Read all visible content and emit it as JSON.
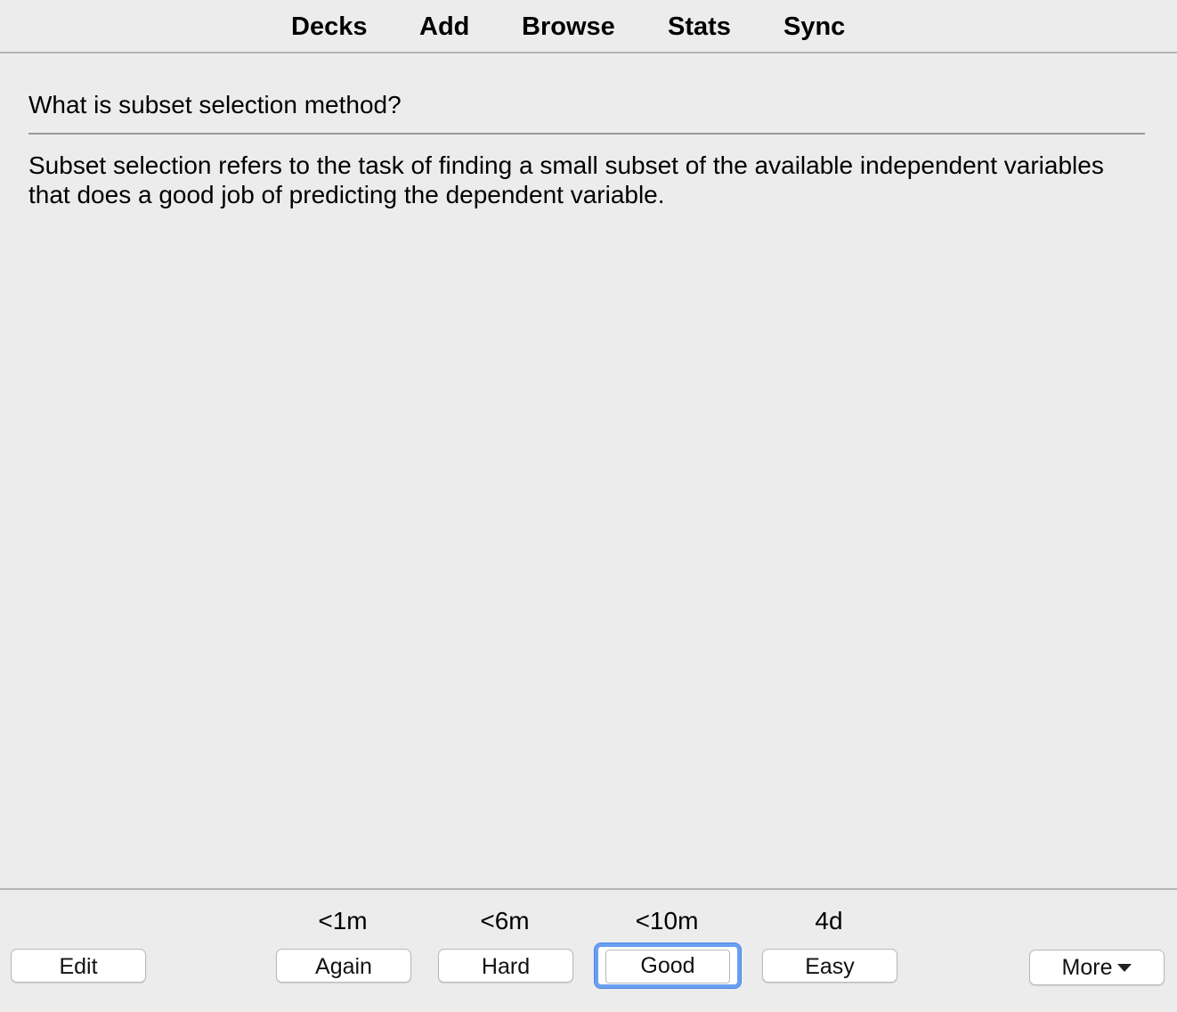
{
  "toolbar": {
    "decks": "Decks",
    "add": "Add",
    "browse": "Browse",
    "stats": "Stats",
    "sync": "Sync"
  },
  "card": {
    "question": "What is subset selection method?",
    "answer": "Subset selection refers to the task of finding a small subset of the available independent variables that does a good job of predicting the dependent variable."
  },
  "answer_buttons": {
    "edit": "Edit",
    "again": {
      "label": "Again",
      "interval": "<1m"
    },
    "hard": {
      "label": "Hard",
      "interval": "<6m"
    },
    "good": {
      "label": "Good",
      "interval": "<10m"
    },
    "easy": {
      "label": "Easy",
      "interval": "4d"
    },
    "more": "More",
    "more_icon": "caret-down-icon",
    "focus_color": "#6a9ff0"
  }
}
